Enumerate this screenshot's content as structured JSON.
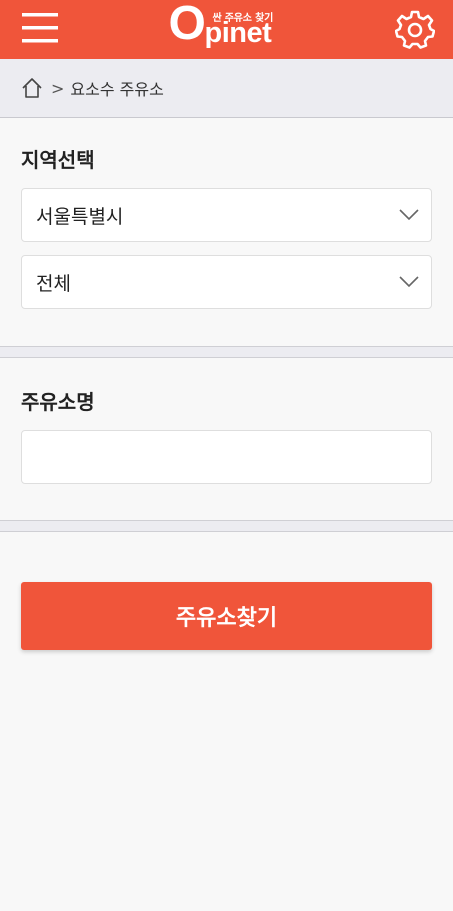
{
  "header": {
    "logo_sub": "싼 주유소 찾기",
    "logo_o": "O",
    "logo_rest": "pinet",
    "menu_icon": "menu-icon",
    "settings_icon": "gear-icon",
    "bg_color": "#f0553a"
  },
  "breadcrumb": {
    "home_icon": "home-icon",
    "separator": ">",
    "current": "요소수 주유소"
  },
  "region": {
    "title": "지역선택",
    "city_value": "서울특별시",
    "district_value": "전체"
  },
  "station": {
    "title": "주유소명",
    "input_value": "",
    "input_placeholder": ""
  },
  "actions": {
    "search_label": "주유소찾기",
    "accent_color": "#f0553a"
  }
}
